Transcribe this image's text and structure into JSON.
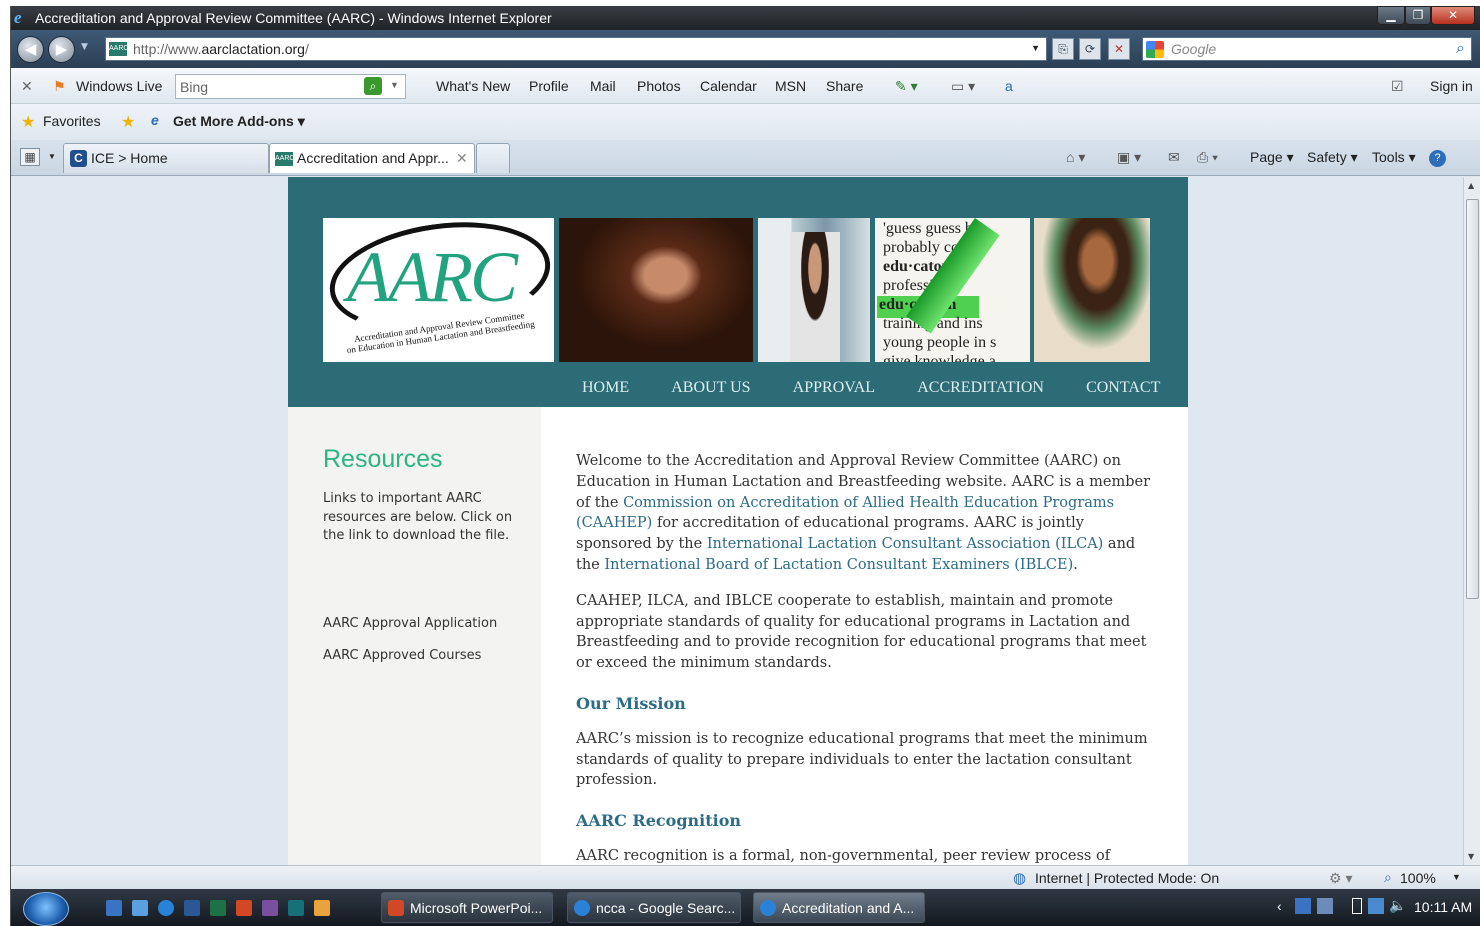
{
  "window": {
    "title": "Accreditation and Approval Review Committee (AARC) - Windows Internet Explorer"
  },
  "address": {
    "url_prefix": "http://www.",
    "url_domain": "aarclactation.org",
    "url_suffix": "/"
  },
  "search": {
    "placeholder": "Google"
  },
  "windows_live": {
    "label": "Windows Live",
    "search_value": "Bing",
    "links": [
      "What's New",
      "Profile",
      "Mail",
      "Photos",
      "Calendar",
      "MSN",
      "Share"
    ],
    "sign_in": "Sign in"
  },
  "favorites": {
    "label": "Favorites",
    "addons": "Get More Add-ons"
  },
  "tabs": [
    {
      "label": "ICE > Home"
    },
    {
      "label": "Accreditation and Appr..."
    }
  ],
  "commands": {
    "page": "Page",
    "safety": "Safety",
    "tools": "Tools"
  },
  "site": {
    "logo_text": "AARC",
    "logo_sub1": "Accreditation and Approval Review Committee",
    "logo_sub2": "on Education in Human Lactation and Breastfeeding",
    "photo_words": [
      "'guess guess bas",
      "probably corre",
      "edu·cator",
      "professional",
      "edu·ca·tion",
      "training and ins",
      "young people in s",
      "give knowledge a"
    ],
    "nav": [
      "HOME",
      "ABOUT US",
      "APPROVAL",
      "ACCREDITATION",
      "CONTACT"
    ],
    "sidebar": {
      "title": "Resources",
      "blurb": "Links to important AARC resources are below. Click on the link to download the file.",
      "links": [
        "AARC Approval Application",
        "AARC Approved Courses"
      ]
    },
    "main": {
      "p1_a": "Welcome to the Accreditation and Approval Review Committee (AARC) on Education in Human Lactation and Breastfeeding website. AARC is a member of the ",
      "p1_link1": "Commission on Accreditation of Allied Health Education Programs (CAAHEP)",
      "p1_b": " for accreditation of educational programs. AARC is jointly sponsored by the ",
      "p1_link2": "International Lactation Consultant Association (ILCA)",
      "p1_c": " and the ",
      "p1_link3": "International Board of Lactation Consultant Examiners (IBLCE)",
      "p1_d": ".",
      "p2": "CAAHEP, ILCA, and IBLCE cooperate to establish, maintain and promote appropriate standards of quality for educational programs in Lactation and Breastfeeding and to provide recognition for educational programs that meet or exceed the minimum standards.",
      "h_mission": "Our Mission",
      "p3": "AARC’s mission is to recognize educational programs that meet the minimum standards of quality to prepare individuals to enter the lactation consultant profession.",
      "h_recognition": "AARC Recognition",
      "p4": "AARC recognition is a formal, non-governmental, peer review process of"
    }
  },
  "status": {
    "zone": "Internet | Protected Mode: On",
    "zoom": "100%"
  },
  "taskbar": {
    "buttons": [
      "Microsoft PowerPoi...",
      "ncca - Google Searc...",
      "Accreditation and A..."
    ],
    "clock": "10:11 AM"
  },
  "colors": {
    "header_teal": "#2c6c77",
    "aarc_green": "#22a27e",
    "link_blue": "#2c6c88"
  }
}
